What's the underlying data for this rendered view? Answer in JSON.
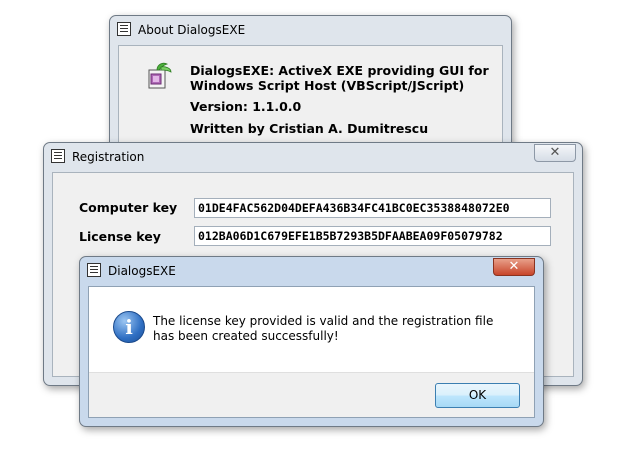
{
  "about_window": {
    "title": "About DialogsEXE",
    "description": "DialogsEXE: ActiveX EXE providing GUI for Windows Script Host (VBScript/JScript)",
    "description_line1": "DialogsEXE: ActiveX EXE providing GUI for",
    "description_line2": "Windows Script Host (VBScript/JScript)",
    "version": "Version: 1.1.0.0",
    "author": "Written by Cristian A. Dumitrescu",
    "close_glyph": "✕"
  },
  "registration_window": {
    "title": "Registration",
    "computer_key_label": "Computer key",
    "computer_key_value": "01DE4FAC562D04DEFA436B34FC41BC0EC3538848072E0",
    "license_key_label": "License key",
    "license_key_value": "012BA06D1C679EFE1B5B7293B5DFAABEA09F05079782",
    "close_glyph": "✕"
  },
  "message_box": {
    "title": "DialogsEXE",
    "message": "The license key provided is valid and the registration file has been created successfully!",
    "icon": "information-icon",
    "icon_glyph": "i",
    "ok_label": "OK",
    "close_glyph": "✕"
  },
  "colors": {
    "titlebar_glass": "#dfe5ec",
    "message_frame": "#c9d9ec",
    "ok_button_border": "#3c7fb1"
  }
}
